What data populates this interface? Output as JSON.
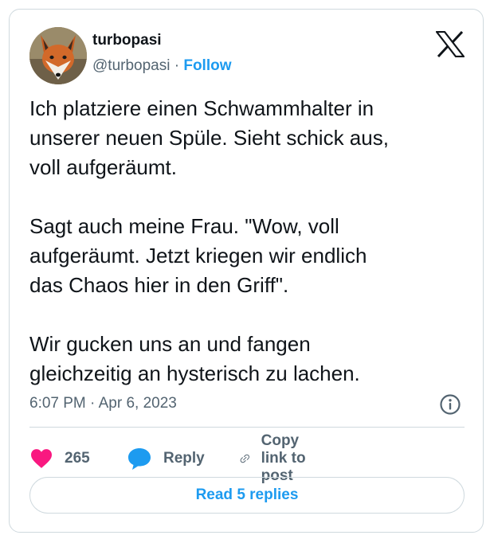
{
  "author": {
    "display_name": "turbopasi",
    "handle": "@turbopasi",
    "separator": " · ",
    "follow_label": "Follow"
  },
  "tweet": {
    "text": "Ich platziere einen Schwammhalter in\nunserer neuen Spüle. Sieht schick aus,\nvoll aufgeräumt.\n\nSagt auch meine Frau. \"Wow, voll\naufgeräumt. Jetzt kriegen wir endlich\ndas Chaos hier in den Griff\".\n\nWir gucken uns an und fangen\ngleichzeitig an hysterisch zu lachen.",
    "timestamp": "6:07 PM · Apr 6, 2023"
  },
  "actions": {
    "like_count": "265",
    "reply_label": "Reply",
    "copy_link_label": "Copy link to post"
  },
  "footer": {
    "read_replies_label": "Read 5 replies"
  },
  "icons": {
    "brand": "x-logo-icon",
    "like": "heart-icon",
    "reply": "speech-bubble-icon",
    "copy": "link-icon",
    "info": "info-icon"
  },
  "colors": {
    "accent": "#1d9bf0",
    "like": "#f91880",
    "text": "#0f1419",
    "secondary_text": "#536471",
    "border": "#cfd9de"
  }
}
